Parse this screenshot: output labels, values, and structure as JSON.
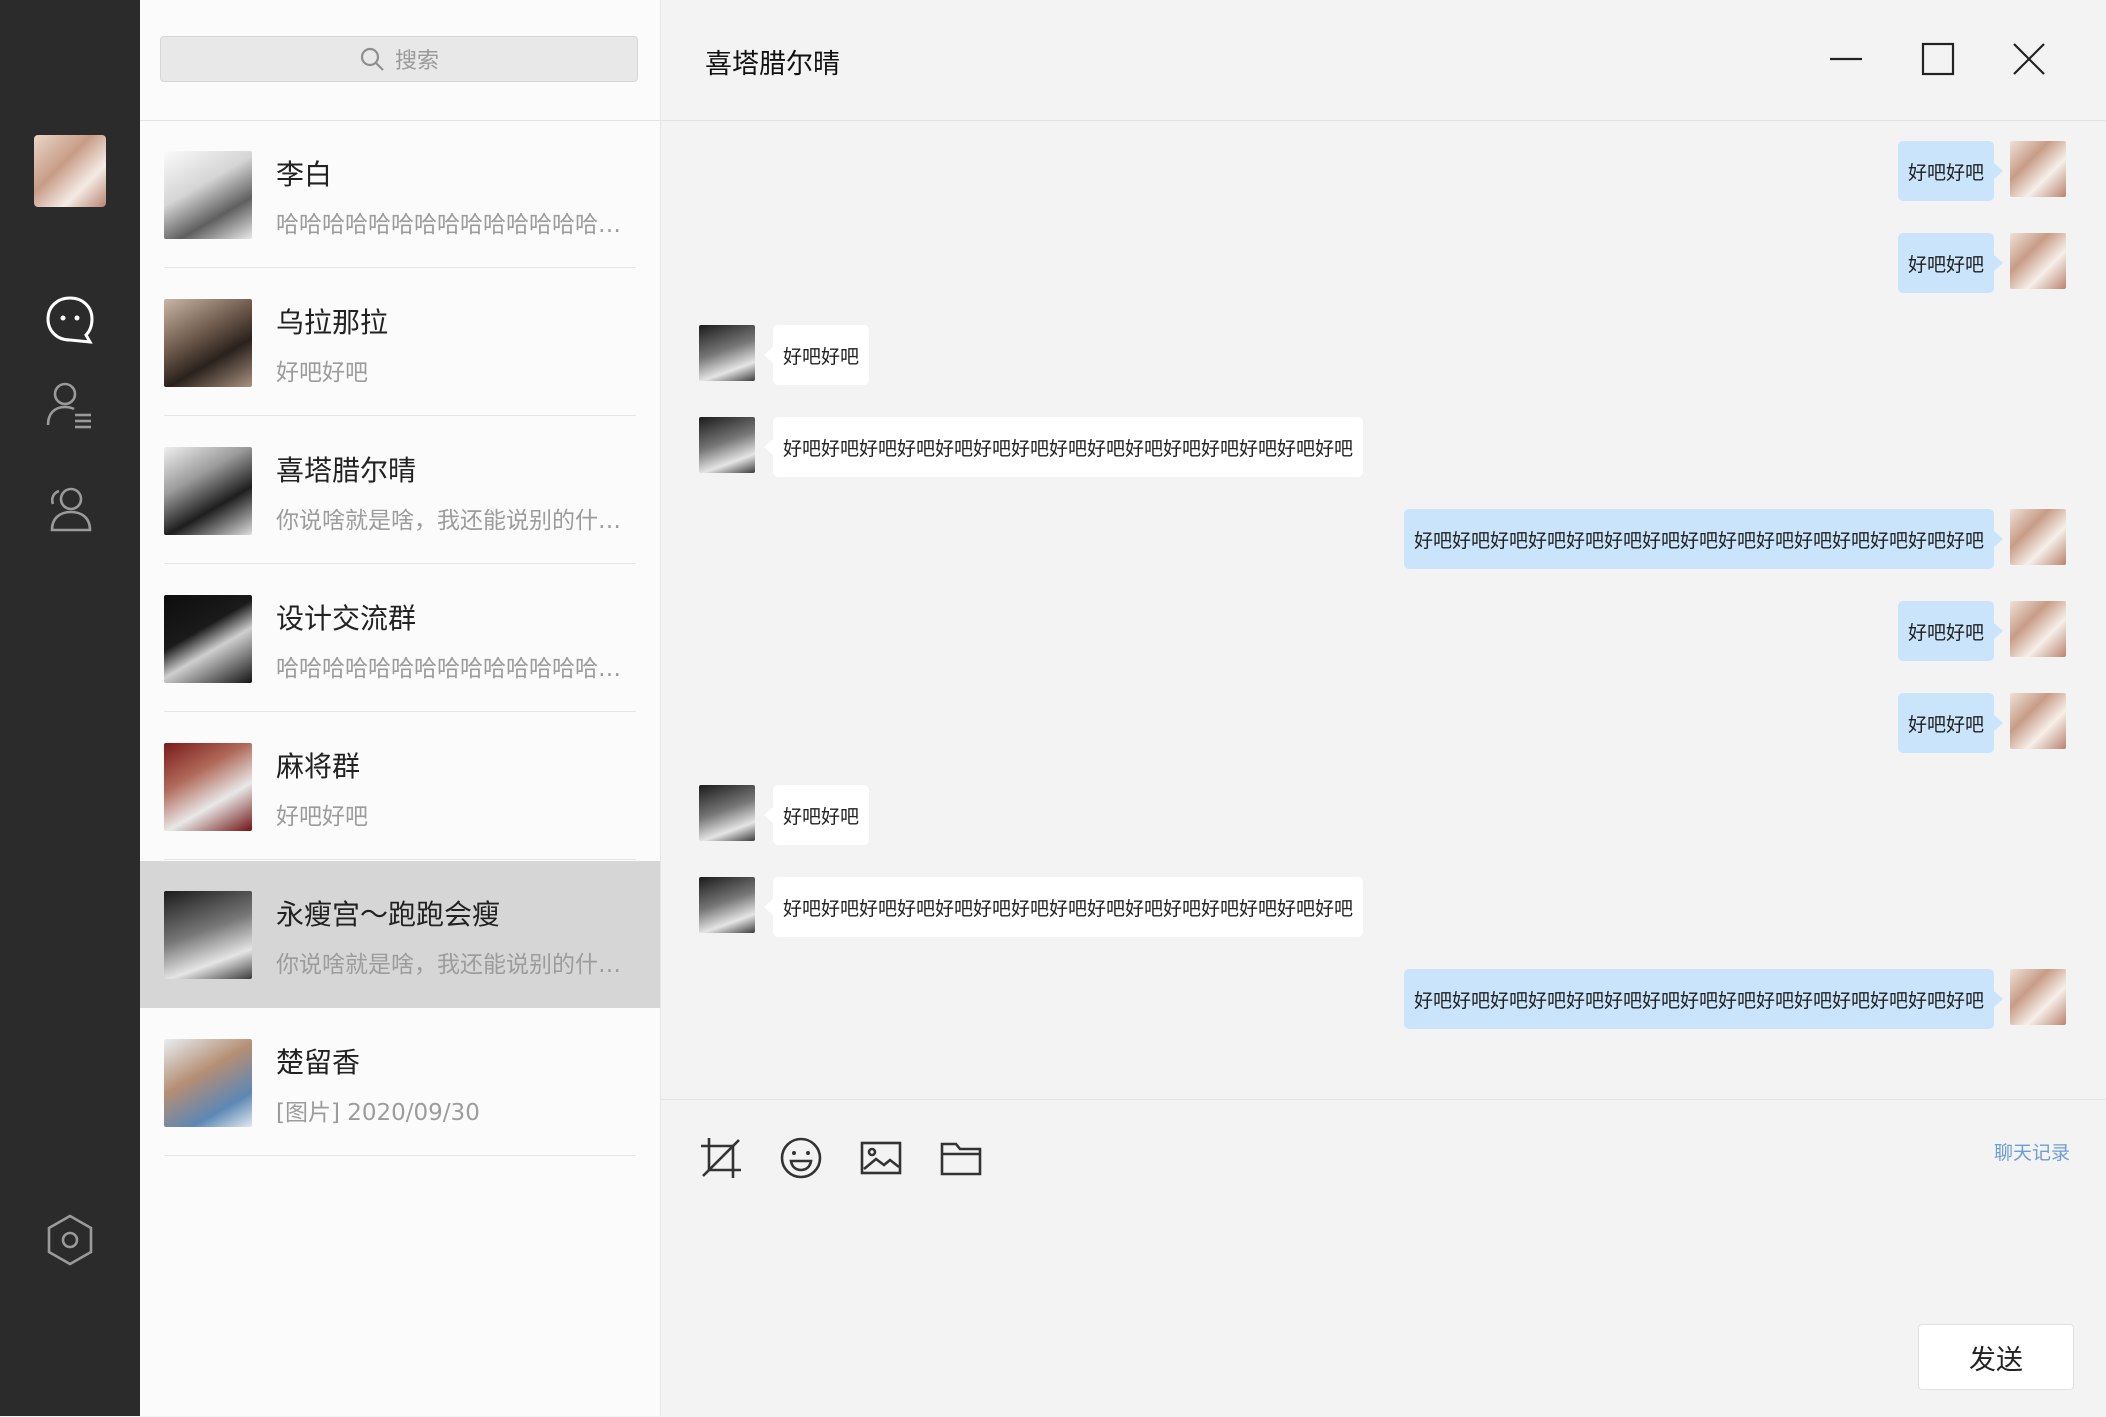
{
  "sidebar": {
    "icons": [
      "chat-icon",
      "contacts-icon",
      "groups-icon",
      "settings-icon"
    ]
  },
  "search": {
    "placeholder": "搜索"
  },
  "conversations": [
    {
      "name": "李白",
      "preview": "哈哈哈哈哈哈哈哈哈哈哈哈哈哈哈哈哈哈哈哈",
      "active": false
    },
    {
      "name": "乌拉那拉",
      "preview": "好吧好吧",
      "active": false
    },
    {
      "name": "喜塔腊尔晴",
      "preview": "你说啥就是啥，我还能说别的什么呢",
      "active": false
    },
    {
      "name": "设计交流群",
      "preview": "哈哈哈哈哈哈哈哈哈哈哈哈哈哈哈哈哈哈哈哈",
      "active": false
    },
    {
      "name": "麻将群",
      "preview": "好吧好吧",
      "active": false
    },
    {
      "name": "永瘦宫～跑跑会瘦",
      "preview": "你说啥就是啥，我还能说别的什么呢",
      "active": true
    },
    {
      "name": "楚留香",
      "preview": "[图片] 2020/09/30",
      "active": false
    }
  ],
  "chat": {
    "title": "喜塔腊尔晴",
    "messages": [
      {
        "from": "me",
        "text": "好吧好吧"
      },
      {
        "from": "me",
        "text": "好吧好吧"
      },
      {
        "from": "them",
        "text": "好吧好吧"
      },
      {
        "from": "them",
        "text": "好吧好吧好吧好吧好吧好吧好吧好吧好吧好吧好吧好吧好吧好吧好吧"
      },
      {
        "from": "me",
        "text": "好吧好吧好吧好吧好吧好吧好吧好吧好吧好吧好吧好吧好吧好吧好吧"
      },
      {
        "from": "me",
        "text": "好吧好吧"
      },
      {
        "from": "me",
        "text": "好吧好吧"
      },
      {
        "from": "them",
        "text": "好吧好吧"
      },
      {
        "from": "them",
        "text": "好吧好吧好吧好吧好吧好吧好吧好吧好吧好吧好吧好吧好吧好吧好吧"
      },
      {
        "from": "me",
        "text": "好吧好吧好吧好吧好吧好吧好吧好吧好吧好吧好吧好吧好吧好吧好吧"
      }
    ]
  },
  "composer": {
    "tools": [
      "crop-icon",
      "emoji-icon",
      "image-icon",
      "folder-icon"
    ],
    "history_label": "聊天记录",
    "send_label": "发送"
  },
  "colors": {
    "rail": "#2b2b2b",
    "my_bubble": "#c9e4fb",
    "their_bubble": "#ffffff",
    "active_conversation": "#d6d6d6",
    "history_link": "#6d9dd6"
  }
}
